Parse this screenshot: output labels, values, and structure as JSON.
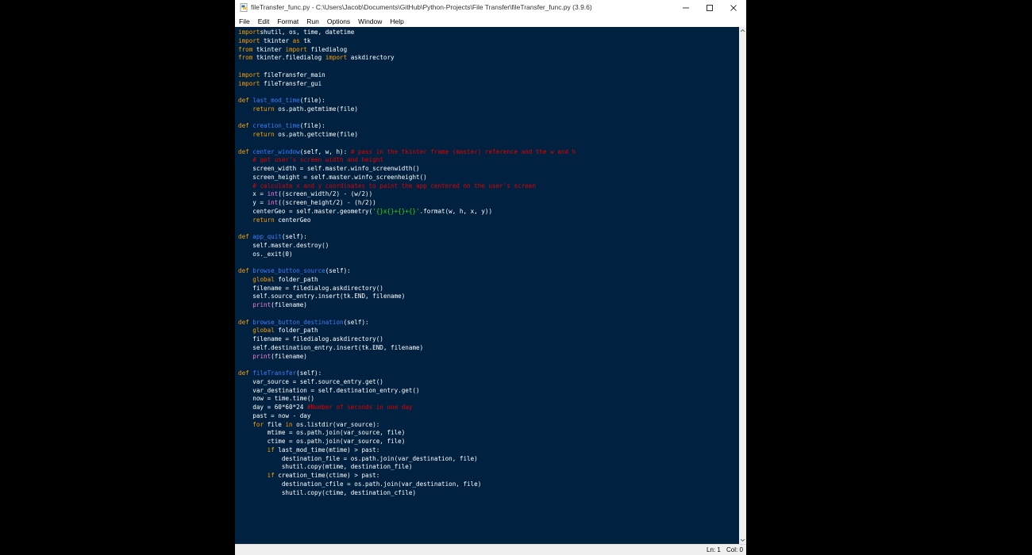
{
  "window": {
    "title": "fileTransfer_func.py - C:\\Users\\Jacob\\Documents\\GitHub\\Python-Projects\\File Transfer\\fileTransfer_func.py (3.9.6)",
    "icon": "python-file-icon",
    "controls": {
      "minimize": "minimize-icon",
      "maximize": "maximize-icon",
      "close": "close-icon"
    }
  },
  "menu": {
    "items": [
      {
        "label": "File"
      },
      {
        "label": "Edit"
      },
      {
        "label": "Format"
      },
      {
        "label": "Run"
      },
      {
        "label": "Options"
      },
      {
        "label": "Window"
      },
      {
        "label": "Help"
      }
    ]
  },
  "colors": {
    "editor_background": "#002240",
    "keyword": "#ff9d00",
    "definition": "#3b7dff",
    "string": "#3ad900",
    "comment": "#e00000",
    "builtin": "#ff7ad9",
    "text": "#ffffff"
  },
  "editor": {
    "lines": [
      [
        [
          "kw",
          "import"
        ],
        [
          "",
          "shutil, os, time, datetime"
        ]
      ],
      [
        [
          "kw",
          "import"
        ],
        [
          "",
          " tkinter "
        ],
        [
          "kw",
          "as"
        ],
        [
          "",
          " tk"
        ]
      ],
      [
        [
          "kw",
          "from"
        ],
        [
          "",
          " tkinter "
        ],
        [
          "kw",
          "import"
        ],
        [
          "",
          " filedialog"
        ]
      ],
      [
        [
          "kw",
          "from"
        ],
        [
          "",
          " tkinter.filedialog "
        ],
        [
          "kw",
          "import"
        ],
        [
          "",
          " askdirectory"
        ]
      ],
      [],
      [
        [
          "kw",
          "import"
        ],
        [
          "",
          " fileTransfer_main"
        ]
      ],
      [
        [
          "kw",
          "import"
        ],
        [
          "",
          " fileTransfer_gui"
        ]
      ],
      [],
      [
        [
          "kw",
          "def"
        ],
        [
          "",
          " "
        ],
        [
          "def",
          "last_mod_time"
        ],
        [
          "",
          "(file):"
        ]
      ],
      [
        [
          "",
          "    "
        ],
        [
          "kw",
          "return"
        ],
        [
          "",
          " os.path.getmtime(file)"
        ]
      ],
      [],
      [
        [
          "kw",
          "def"
        ],
        [
          "",
          " "
        ],
        [
          "def",
          "creation_time"
        ],
        [
          "",
          "(file):"
        ]
      ],
      [
        [
          "",
          "    "
        ],
        [
          "kw",
          "return"
        ],
        [
          "",
          " os.path.getctime(file)"
        ]
      ],
      [],
      [
        [
          "kw",
          "def"
        ],
        [
          "",
          " "
        ],
        [
          "def",
          "center_window"
        ],
        [
          "",
          "(self, w, h): "
        ],
        [
          "com",
          "# pass in the tkinter frame (master) reference and the w and h"
        ]
      ],
      [
        [
          "",
          "    "
        ],
        [
          "com",
          "# get user's screen width and height"
        ]
      ],
      [
        [
          "",
          "    screen_width = self.master.winfo_screenwidth()"
        ]
      ],
      [
        [
          "",
          "    screen_height = self.master.winfo_screenheight()"
        ]
      ],
      [
        [
          "",
          "    "
        ],
        [
          "com",
          "# calculate x and y coordinates to paint the app centered on the user's screen"
        ]
      ],
      [
        [
          "",
          "    x = "
        ],
        [
          "builtin",
          "int"
        ],
        [
          "",
          "((screen_width/2) - (w/2))"
        ]
      ],
      [
        [
          "",
          "    y = "
        ],
        [
          "builtin",
          "int"
        ],
        [
          "",
          "((screen_height/2) - (h/2))"
        ]
      ],
      [
        [
          "",
          "    centerGeo = self.master.geometry("
        ],
        [
          "str",
          "'{}x{}+{}+{}'"
        ],
        [
          "",
          ".format(w, h, x, y))"
        ]
      ],
      [
        [
          "",
          "    "
        ],
        [
          "kw",
          "return"
        ],
        [
          "",
          " centerGeo"
        ]
      ],
      [],
      [
        [
          "kw",
          "def"
        ],
        [
          "",
          " "
        ],
        [
          "def",
          "app_quit"
        ],
        [
          "",
          "(self):"
        ]
      ],
      [
        [
          "",
          "    self.master.destroy()"
        ]
      ],
      [
        [
          "",
          "    os._exit(0)"
        ]
      ],
      [],
      [
        [
          "kw",
          "def"
        ],
        [
          "",
          " "
        ],
        [
          "def",
          "browse_button_source"
        ],
        [
          "",
          "(self):"
        ]
      ],
      [
        [
          "",
          "    "
        ],
        [
          "kw",
          "global"
        ],
        [
          "",
          " folder_path"
        ]
      ],
      [
        [
          "",
          "    filename = filedialog.askdirectory()"
        ]
      ],
      [
        [
          "",
          "    self.source_entry.insert(tk.END, filename)"
        ]
      ],
      [
        [
          "",
          "    "
        ],
        [
          "builtin",
          "print"
        ],
        [
          "",
          "(filename)"
        ]
      ],
      [],
      [
        [
          "kw",
          "def"
        ],
        [
          "",
          " "
        ],
        [
          "def",
          "browse_button_destination"
        ],
        [
          "",
          "(self):"
        ]
      ],
      [
        [
          "",
          "    "
        ],
        [
          "kw",
          "global"
        ],
        [
          "",
          " folder_path"
        ]
      ],
      [
        [
          "",
          "    filename = filedialog.askdirectory()"
        ]
      ],
      [
        [
          "",
          "    self.destination_entry.insert(tk.END, filename)"
        ]
      ],
      [
        [
          "",
          "    "
        ],
        [
          "builtin",
          "print"
        ],
        [
          "",
          "(filename)"
        ]
      ],
      [],
      [
        [
          "kw",
          "def"
        ],
        [
          "",
          " "
        ],
        [
          "def",
          "fileTransfer"
        ],
        [
          "",
          "(self):"
        ]
      ],
      [
        [
          "",
          "    var_source = self.source_entry.get()"
        ]
      ],
      [
        [
          "",
          "    var_destination = self.destination_entry.get()"
        ]
      ],
      [
        [
          "",
          "    now = time.time()"
        ]
      ],
      [
        [
          "",
          "    day = 60*60*24 "
        ],
        [
          "com",
          "#Number of seconds in one day"
        ]
      ],
      [
        [
          "",
          "    past = now - day"
        ]
      ],
      [
        [
          "",
          "    "
        ],
        [
          "kw",
          "for"
        ],
        [
          "",
          " file "
        ],
        [
          "kw",
          "in"
        ],
        [
          "",
          " os.listdir(var_source):"
        ]
      ],
      [
        [
          "",
          "        mtime = os.path.join(var_source, file)"
        ]
      ],
      [
        [
          "",
          "        ctime = os.path.join(var_source, file)"
        ]
      ],
      [
        [
          "",
          "        "
        ],
        [
          "kw",
          "if"
        ],
        [
          "",
          " last_mod_time(mtime) > past:"
        ]
      ],
      [
        [
          "",
          "            destination_file = os.path.join(var_destination, file)"
        ]
      ],
      [
        [
          "",
          "            shutil.copy(mtime, destination_file)"
        ]
      ],
      [
        [
          "",
          "        "
        ],
        [
          "kw",
          "if"
        ],
        [
          "",
          " creation_time(ctime) > past:"
        ]
      ],
      [
        [
          "",
          "            destination_cfile = os.path.join(var_destination, file)"
        ]
      ],
      [
        [
          "",
          "            shutil.copy(ctime, destination_cfile)"
        ]
      ]
    ]
  },
  "status": {
    "line": "Ln: 1",
    "col": "Col: 0"
  }
}
